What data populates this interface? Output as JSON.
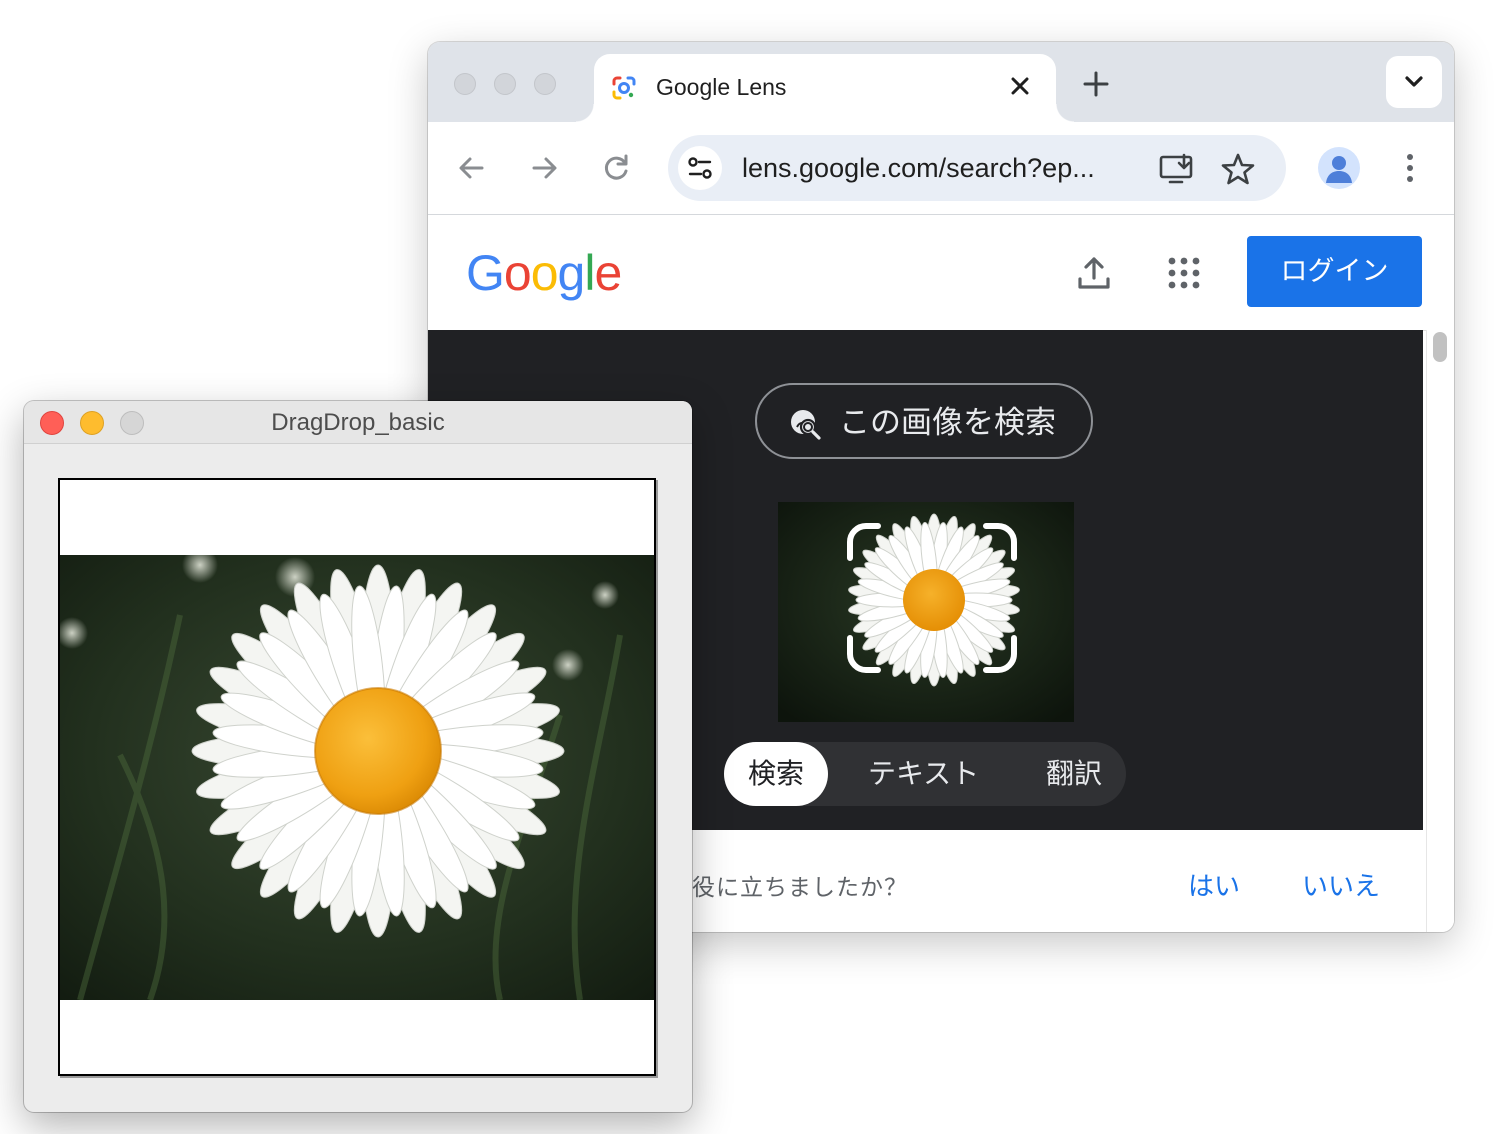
{
  "browser": {
    "tab_title": "Google Lens",
    "url": "lens.google.com/search?ep...",
    "icons": {
      "favicon": "google-lens-icon",
      "close": "close-icon",
      "new_tab": "plus-icon",
      "tab_search": "chevron-down-icon",
      "back": "arrow-back-icon",
      "forward": "arrow-forward-icon",
      "reload": "reload-icon",
      "site_info": "tune-icon",
      "install": "install-app-icon",
      "bookmark": "star-icon",
      "profile": "person-icon",
      "menu": "more-vert-icon"
    }
  },
  "page": {
    "logo": "Google",
    "login_label": "ログイン",
    "search_image_label": "この画像を検索",
    "modes": [
      "検索",
      "テキスト",
      "翻訳"
    ],
    "feedback_question": "役に立ちましたか？",
    "feedback_yes": "はい",
    "feedback_no": "いいえ",
    "colors": {
      "accent": "#1a73e8",
      "dark_bg": "#202124",
      "logo_blue": "#4285f4",
      "logo_red": "#ea4335",
      "logo_yellow": "#fbbc05",
      "logo_green": "#34a853"
    }
  },
  "app": {
    "title": "DragDrop_basic",
    "image_subject": "daisy-photo"
  }
}
